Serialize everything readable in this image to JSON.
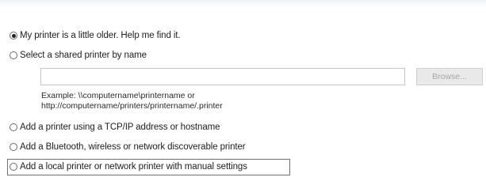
{
  "options": {
    "older": {
      "label": "My printer is a little older. Help me find it.",
      "selected": true
    },
    "shared": {
      "label": "Select a shared printer by name",
      "selected": false
    },
    "tcp": {
      "label": "Add a printer using a TCP/IP address or hostname",
      "selected": false
    },
    "bluetooth": {
      "label": "Add a Bluetooth, wireless or network discoverable printer",
      "selected": false
    },
    "local": {
      "label": "Add a local printer or network printer with manual settings",
      "selected": false
    }
  },
  "shared_name": {
    "value": "",
    "browse_label": "Browse..."
  },
  "example": {
    "line1": "Example: \\\\computername\\printername or",
    "line2": "http://computername/printers/printername/.printer"
  },
  "colors": {
    "highlight": "#e0462b"
  }
}
